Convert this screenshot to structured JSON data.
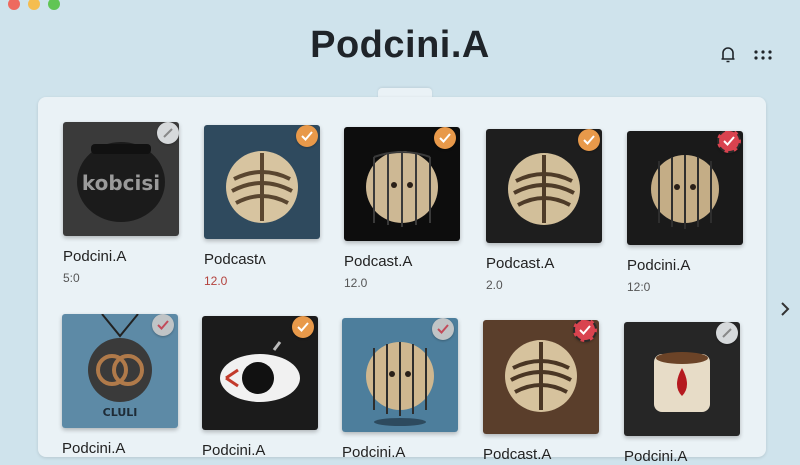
{
  "app": {
    "title": "Podcini.A"
  },
  "header": {
    "notifications_icon": "bell-icon",
    "menu_icon": "grid-dots-icon"
  },
  "navigation": {
    "next_icon": "chevron-right-icon"
  },
  "colors": {
    "accent_orange": "#e8994a",
    "accent_red": "#d9434f",
    "background": "#cfe3ec",
    "panel": "#eaf2f6"
  },
  "podcasts": [
    {
      "name": "Podcini.A",
      "value": "5:0",
      "check_state": "unchecked",
      "artwork": "black-pot-logo",
      "artwork_text": "kobcisi"
    },
    {
      "name": "Podcastʌ",
      "value": "12.0",
      "check_state": "checked-orange",
      "artwork": "brain-sphere-blue"
    },
    {
      "name": "Podcast.A",
      "value": "12.0",
      "check_state": "checked-orange",
      "artwork": "caged-face-sphere"
    },
    {
      "name": "Podcast.A",
      "value": "2.0",
      "check_state": "checked-orange",
      "artwork": "brain-sphere-dark"
    },
    {
      "name": "Podcini.A",
      "value": "12:0",
      "check_state": "checked-red",
      "artwork": "caged-face-sphere-dark"
    },
    {
      "name": "Podcini.A",
      "value": "",
      "check_state": "checked-gray",
      "artwork": "woven-sphere-pendant",
      "artwork_text": "CLULI"
    },
    {
      "name": "Podcini.A",
      "value": "",
      "check_state": "checked-orange",
      "artwork": "eye-capsule"
    },
    {
      "name": "Podcini.A",
      "value": "",
      "check_state": "checked-gray",
      "artwork": "caged-face-sphere-blue"
    },
    {
      "name": "Podcast.A",
      "value": "",
      "check_state": "checked-red",
      "artwork": "brain-sphere-brown"
    },
    {
      "name": "Podcini.A",
      "value": "",
      "check_state": "unchecked",
      "artwork": "coffee-cup-drop"
    }
  ]
}
